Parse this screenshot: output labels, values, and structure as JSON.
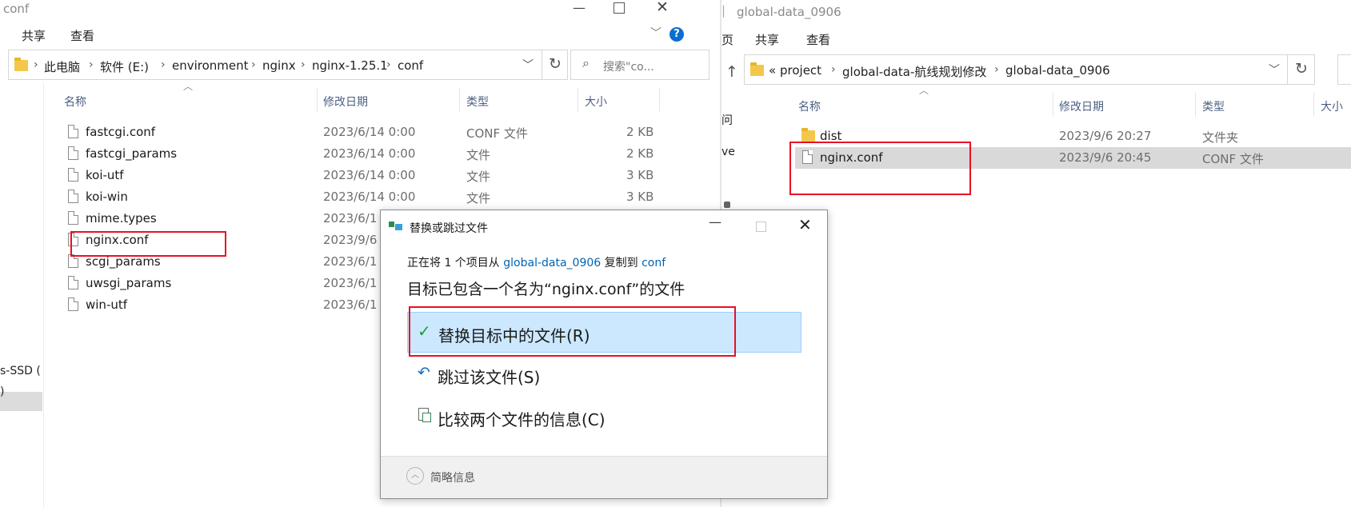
{
  "left_window": {
    "title": "conf",
    "ribbon_tabs": [
      "共享",
      "查看"
    ],
    "help_icon_label": "?",
    "breadcrumb": [
      "此电脑",
      "软件 (E:)",
      "environment",
      "nginx",
      "nginx-1.25.1",
      "conf"
    ],
    "search_placeholder": "搜索\"co...",
    "columns": [
      "名称",
      "修改日期",
      "类型",
      "大小"
    ],
    "files": [
      {
        "name": "fastcgi.conf",
        "date": "2023/6/14 0:00",
        "type": "CONF 文件",
        "size": "2 KB"
      },
      {
        "name": "fastcgi_params",
        "date": "2023/6/14 0:00",
        "type": "文件",
        "size": "2 KB"
      },
      {
        "name": "koi-utf",
        "date": "2023/6/14 0:00",
        "type": "文件",
        "size": "3 KB"
      },
      {
        "name": "koi-win",
        "date": "2023/6/14 0:00",
        "type": "文件",
        "size": "3 KB"
      },
      {
        "name": "mime.types",
        "date": "2023/6/1",
        "type": "",
        "size": ""
      },
      {
        "name": "nginx.conf",
        "date": "2023/9/6",
        "type": "",
        "size": ""
      },
      {
        "name": "scgi_params",
        "date": "2023/6/1",
        "type": "",
        "size": ""
      },
      {
        "name": "uwsgi_params",
        "date": "2023/6/1",
        "type": "",
        "size": ""
      },
      {
        "name": "win-utf",
        "date": "2023/6/1",
        "type": "",
        "size": ""
      }
    ],
    "nav_fragments": [
      "s-SSD (",
      ")"
    ]
  },
  "right_window": {
    "title": "global-data_0906",
    "ribbon_tabs": [
      "页",
      "共享",
      "查看"
    ],
    "breadcrumb": [
      "«",
      "project",
      "global-data-航线规划修改",
      "global-data_0906"
    ],
    "columns": [
      "名称",
      "修改日期",
      "类型",
      "大小"
    ],
    "files": [
      {
        "name": "dist",
        "date": "2023/9/6 20:27",
        "type": "文件夹",
        "kind": "folder"
      },
      {
        "name": "nginx.conf",
        "date": "2023/9/6 20:45",
        "type": "CONF 文件",
        "kind": "file"
      }
    ],
    "nav_fragments": [
      "问",
      "ve"
    ]
  },
  "dialog": {
    "title": "替换或跳过文件",
    "info_prefix": "正在将 1 个项目从",
    "info_source": "global-data_0906",
    "info_middle": "复制到",
    "info_dest": "conf",
    "heading": "目标已包含一个名为“nginx.conf”的文件",
    "options": [
      "替换目标中的文件(R)",
      "跳过该文件(S)",
      "比较两个文件的信息(C)"
    ],
    "details_label": "简略信息"
  },
  "colors": {
    "highlight": "#cce8ff",
    "highlight_border": "#99d1ff",
    "annotation_red": "#e81123",
    "link_blue": "#0063b1",
    "selected_row": "#d9d9d9"
  }
}
